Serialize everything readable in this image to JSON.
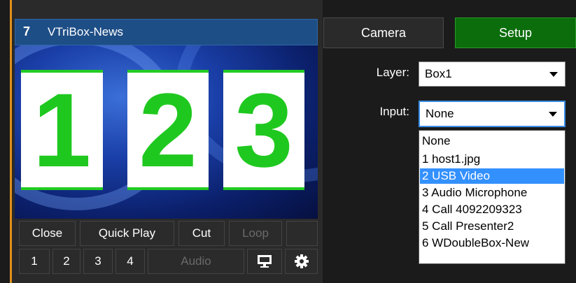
{
  "input": {
    "number": "7",
    "name": "VTriBox-News",
    "preview_tiles": [
      "1",
      "2",
      "3"
    ]
  },
  "controls": {
    "row1": [
      "Close",
      "Quick Play",
      "Cut",
      "Loop"
    ],
    "row2": [
      "1",
      "2",
      "3",
      "4"
    ],
    "audio": "Audio",
    "icons": [
      "monitor-icon",
      "gear-icon"
    ]
  },
  "tabs": {
    "camera": "Camera",
    "setup": "Setup",
    "active": "Setup"
  },
  "form": {
    "layer_label": "Layer:",
    "layer_value": "Box1",
    "input_label": "Input:",
    "input_value": "None"
  },
  "dropdown": {
    "options": [
      "None",
      "1 host1.jpg",
      "2 USB Video",
      "3 Audio Microphone",
      "4 Call 4092209323",
      "5 Call Presenter2",
      "6 WDoubleBox-New"
    ],
    "highlighted": "2 USB Video"
  },
  "colors": {
    "accent_blue": "#1e4e86",
    "setup_green": "#0b6d0b",
    "tile_green": "#1fc81f",
    "highlight": "#3390ff",
    "left_border": "#e0901a"
  }
}
